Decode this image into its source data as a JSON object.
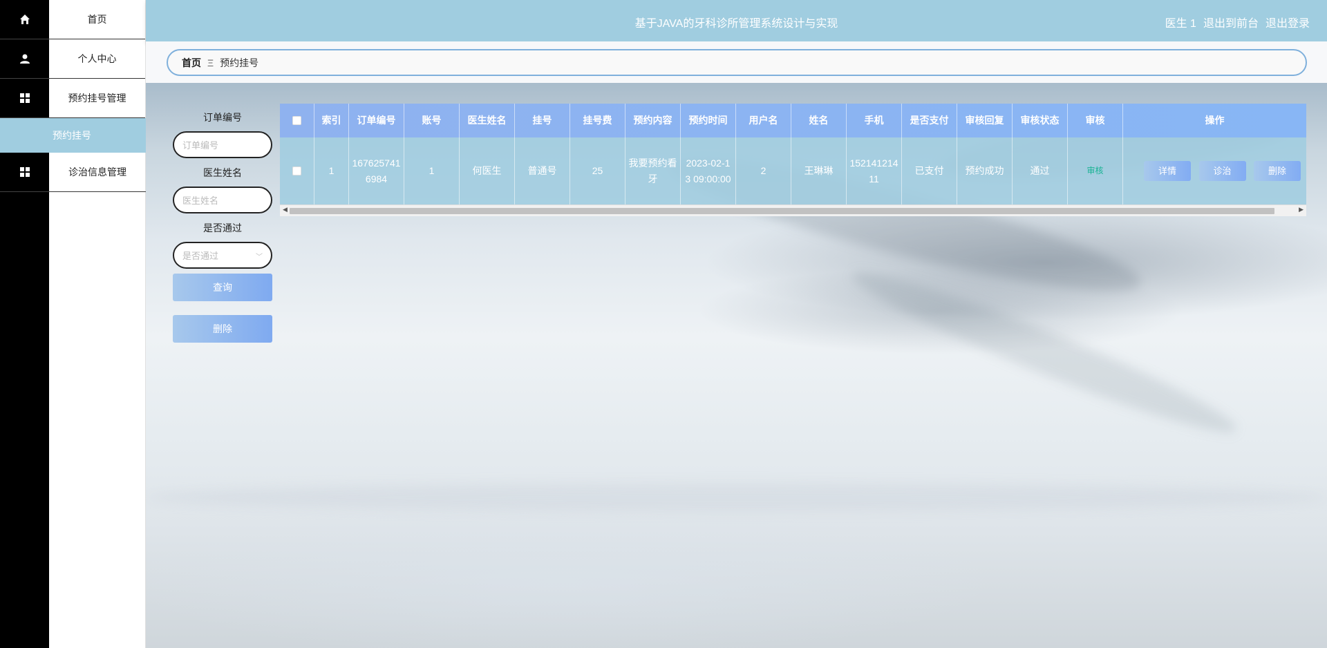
{
  "app": {
    "title": "基于JAVA的牙科诊所管理系统设计与实现",
    "user_label": "医生 1",
    "back_to_front": "退出到前台",
    "logout": "退出登录"
  },
  "sidebar": {
    "items": [
      {
        "label": "首页",
        "icon": "home-icon"
      },
      {
        "label": "个人中心",
        "icon": "user-icon"
      },
      {
        "label": "预约挂号管理",
        "icon": "grid-icon"
      },
      {
        "label": "预约挂号",
        "icon": "",
        "active": true
      },
      {
        "label": "诊治信息管理",
        "icon": "grid-icon"
      }
    ]
  },
  "breadcrumb": {
    "home": "首页",
    "separator": "Ξ",
    "current": "预约挂号"
  },
  "search": {
    "order_no_label": "订单编号",
    "order_no_placeholder": "订单编号",
    "doctor_label": "医生姓名",
    "doctor_placeholder": "医生姓名",
    "passed_label": "是否通过",
    "passed_placeholder": "是否通过",
    "query_button": "查询",
    "delete_button": "删除"
  },
  "table": {
    "headers": [
      "索引",
      "订单编号",
      "账号",
      "医生姓名",
      "挂号",
      "挂号费",
      "预约内容",
      "预约时间",
      "用户名",
      "姓名",
      "手机",
      "是否支付",
      "审核回复",
      "审核状态",
      "审核",
      "操作"
    ],
    "rows": [
      {
        "index": "1",
        "order_no": "1676257416984",
        "account": "1",
        "doctor": "何医生",
        "reg_type": "普通号",
        "fee": "25",
        "content": "我要预约看牙",
        "time": "2023-02-13 09:00:00",
        "username": "2",
        "name": "王琳琳",
        "phone": "15214121411",
        "paid": "已支付",
        "reply": "预约成功",
        "status": "通过",
        "audit": "审核",
        "actions": {
          "detail": "详情",
          "treat": "诊治",
          "delete": "删除"
        }
      }
    ]
  },
  "colors": {
    "header_bg": "#a0cde0",
    "table_head": "#8fb2ef",
    "audit_link": "#19b394",
    "sidebar_rail": "#000000"
  }
}
